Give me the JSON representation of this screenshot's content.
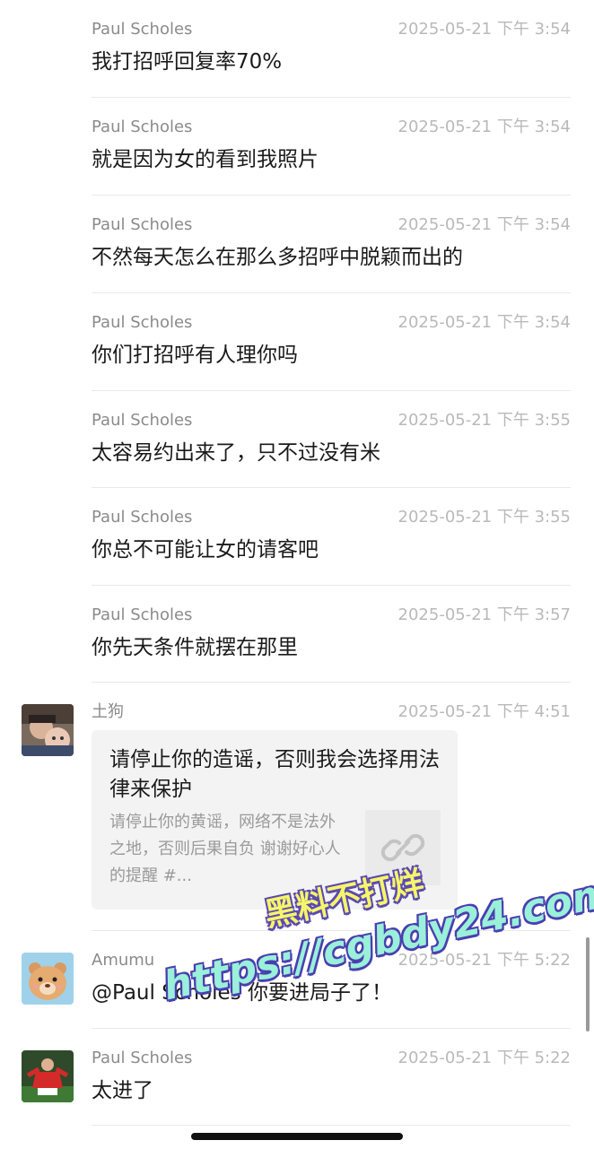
{
  "messages": [
    {
      "sender": "Paul Scholes",
      "time": "2025-05-21 下午 3:54",
      "text": "我打招呼回复率70%"
    },
    {
      "sender": "Paul Scholes",
      "time": "2025-05-21 下午 3:54",
      "text": "就是因为女的看到我照片"
    },
    {
      "sender": "Paul Scholes",
      "time": "2025-05-21 下午 3:54",
      "text": "不然每天怎么在那么多招呼中脱颖而出的"
    },
    {
      "sender": "Paul Scholes",
      "time": "2025-05-21 下午 3:54",
      "text": "你们打招呼有人理你吗"
    },
    {
      "sender": "Paul Scholes",
      "time": "2025-05-21 下午 3:55",
      "text": "太容易约出来了，只不过没有米"
    },
    {
      "sender": "Paul Scholes",
      "time": "2025-05-21 下午 3:55",
      "text": "你总不可能让女的请客吧"
    },
    {
      "sender": "Paul Scholes",
      "time": "2025-05-21 下午 3:57",
      "text": "你先天条件就摆在那里"
    },
    {
      "sender": "土狗",
      "time": "2025-05-21 下午 4:51",
      "link_card": {
        "title": "请停止你的造谣，否则我会选择用法律来保护",
        "description": "请停止你的黄谣，网络不是法外之地，否则后果自负 谢谢好心人的提醒 #...",
        "thumb_icon": "link-icon"
      }
    },
    {
      "sender": "Amumu",
      "time": "2025-05-21 下午 5:22",
      "text": "@Paul Scholes 你要进局子了！"
    },
    {
      "sender": "Paul Scholes",
      "time": "2025-05-21 下午 5:22",
      "text": "太进了"
    }
  ],
  "watermark": {
    "line1": "黑料不打烊",
    "line2": "https://cgbdy24.com"
  },
  "colors": {
    "sender": "#8b8b8b",
    "timestamp": "#b9b9b9",
    "divider": "#e9e9e9",
    "card_bg": "#f3f3f3"
  }
}
